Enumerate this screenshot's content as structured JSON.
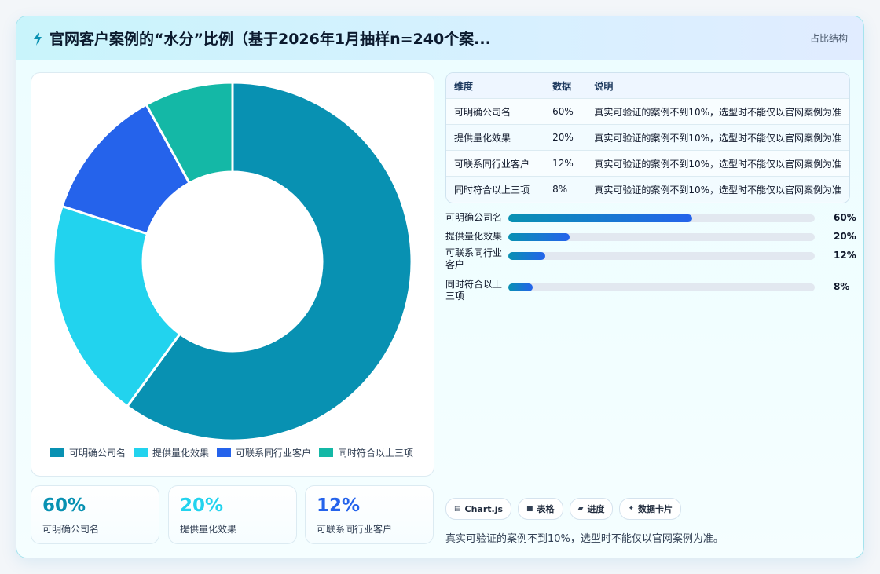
{
  "header": {
    "title": "官网客户案例的“水分”比例（基于2026年1月抽样n=240个案...",
    "tag": "占比结构"
  },
  "chart_data": {
    "type": "pie",
    "categories": [
      "可明确公司名",
      "提供量化效果",
      "可联系同行业客户",
      "同时符合以上三项"
    ],
    "values": [
      60,
      20,
      12,
      8
    ],
    "colors": [
      "#0891b2",
      "#22d3ee",
      "#2563eb",
      "#14b8a6"
    ],
    "legend_position": "bottom"
  },
  "table": {
    "headers": [
      "维度",
      "数据",
      "说明"
    ],
    "rows": [
      [
        "可明确公司名",
        "60%",
        "真实可验证的案例不到10%，选型时不能仅以官网案例为准"
      ],
      [
        "提供量化效果",
        "20%",
        "真实可验证的案例不到10%，选型时不能仅以官网案例为准"
      ],
      [
        "可联系同行业客户",
        "12%",
        "真实可验证的案例不到10%，选型时不能仅以官网案例为准"
      ],
      [
        "同时符合以上三项",
        "8%",
        "真实可验证的案例不到10%，选型时不能仅以官网案例为准"
      ]
    ]
  },
  "progress": [
    {
      "label": "可明确公司名",
      "value": 60,
      "display": "60%"
    },
    {
      "label": "提供量化效果",
      "value": 20,
      "display": "20%"
    },
    {
      "label": "可联系同行业客户",
      "value": 12,
      "display": "12%"
    },
    {
      "label": "同时符合以上三项",
      "value": 8,
      "display": "8%"
    }
  ],
  "stats": [
    {
      "value": "60%",
      "label": "可明确公司名",
      "color": "#0891b2"
    },
    {
      "value": "20%",
      "label": "提供量化效果",
      "color": "#22d3ee"
    },
    {
      "value": "12%",
      "label": "可联系同行业客户",
      "color": "#2563eb"
    }
  ],
  "chips": [
    {
      "icon": "chart-icon",
      "glyph": "▤",
      "label": "Chart.js"
    },
    {
      "icon": "table-icon",
      "glyph": "■",
      "label": "表格"
    },
    {
      "icon": "progress-icon",
      "glyph": "▰",
      "label": "进度"
    },
    {
      "icon": "sparkle-icon",
      "glyph": "✦",
      "label": "数据卡片"
    }
  ],
  "footnote": "真实可验证的案例不到10%，选型时不能仅以官网案例为准。"
}
